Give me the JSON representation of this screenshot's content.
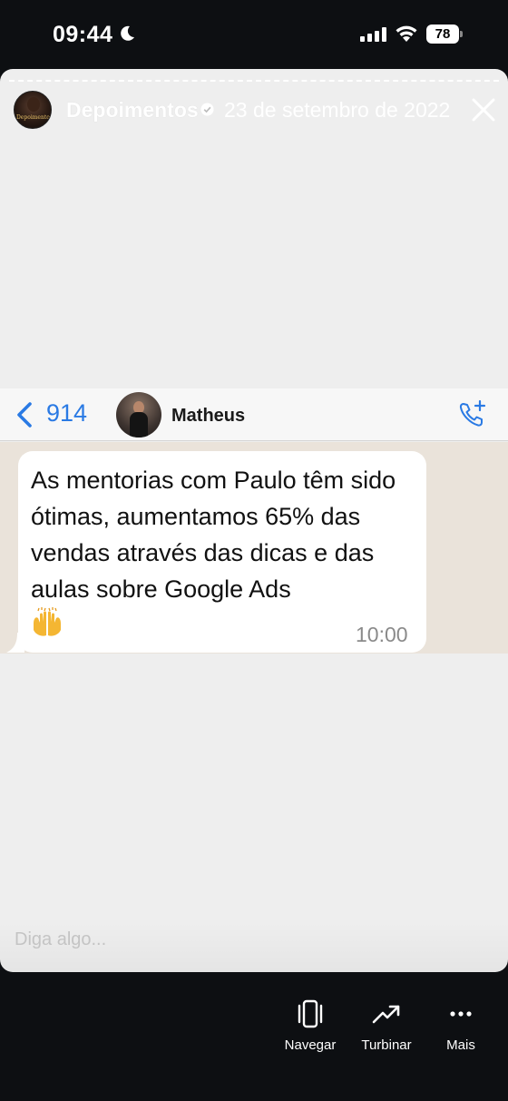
{
  "status_bar": {
    "time": "09:44",
    "battery": "78"
  },
  "story": {
    "account_name": "Depoimentos",
    "avatar_text": "Depoimentos",
    "date": "23 de setembro de 2022",
    "reply_placeholder": "Diga algo..."
  },
  "whatsapp": {
    "back_count": "914",
    "contact_name": "Matheus",
    "message_text": "As mentorias com Paulo têm sido ótimas, aumentamos 65% das vendas através das dicas e das aulas sobre Google Ads",
    "message_time": "10:00",
    "emoji_icon": "raising-hands-icon"
  },
  "actions": [
    {
      "label": "Navegar",
      "icon": "phone-device-icon"
    },
    {
      "label": "Turbinar",
      "icon": "trending-up-icon"
    },
    {
      "label": "Mais",
      "icon": "more-horizontal-icon"
    }
  ],
  "colors": {
    "background": "#0d0f12",
    "story_bg": "#eeeeee",
    "wa_blue": "#2a7ae4",
    "chat_bg": "#eae3da"
  }
}
